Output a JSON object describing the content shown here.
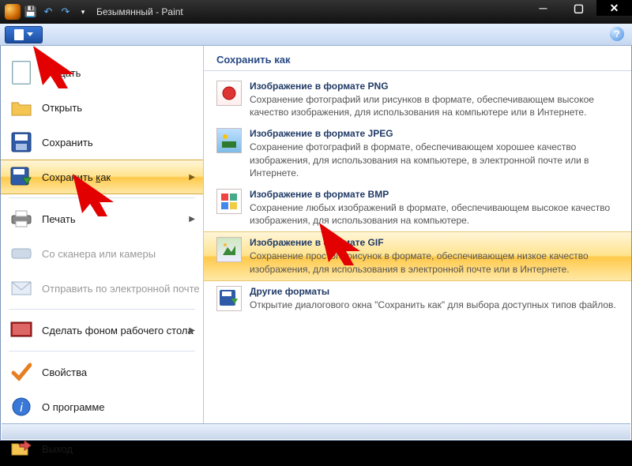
{
  "title": "Безымянный - Paint",
  "help_glyph": "?",
  "arrow_glyph": "▶",
  "menu": {
    "new": "Создать",
    "open": "Открыть",
    "save": "Сохранить",
    "saveas_pre": "Сохранить ",
    "saveas_u": "к",
    "saveas_post": "ак",
    "print": "Печать",
    "scanner": "Со сканера или камеры",
    "email": "Отправить по электронной почте",
    "wallpaper": "Сделать фоном рабочего стола",
    "props": "Свойства",
    "about": "О программе",
    "exit": "Выход"
  },
  "pane": {
    "header": "Сохранить как",
    "formats": [
      {
        "title": "Изображение в формате PNG",
        "desc": "Сохранение фотографий или рисунков в формате, обеспечивающем высокое качество изображения, для использования на компьютере или в Интернете."
      },
      {
        "title": "Изображение в формате JPEG",
        "desc": "Сохранение фотографий в формате, обеспечивающем хорошее качество изображения, для использования на компьютере, в электронной почте или в Интернете."
      },
      {
        "title": "Изображение в формате BMP",
        "desc": "Сохранение любых изображений в формате, обеспечивающем высокое качество изображения, для использования на компьютере."
      },
      {
        "title": "Изображение в формате GIF",
        "desc": "Сохранение простого рисунок в формате, обеспечивающем низкое качество изображения, для использования в электронной почте или в Интернете."
      },
      {
        "title": "Другие форматы",
        "desc": "Открытие диалогового окна \"Сохранить как\" для выбора доступных типов файлов."
      }
    ]
  }
}
